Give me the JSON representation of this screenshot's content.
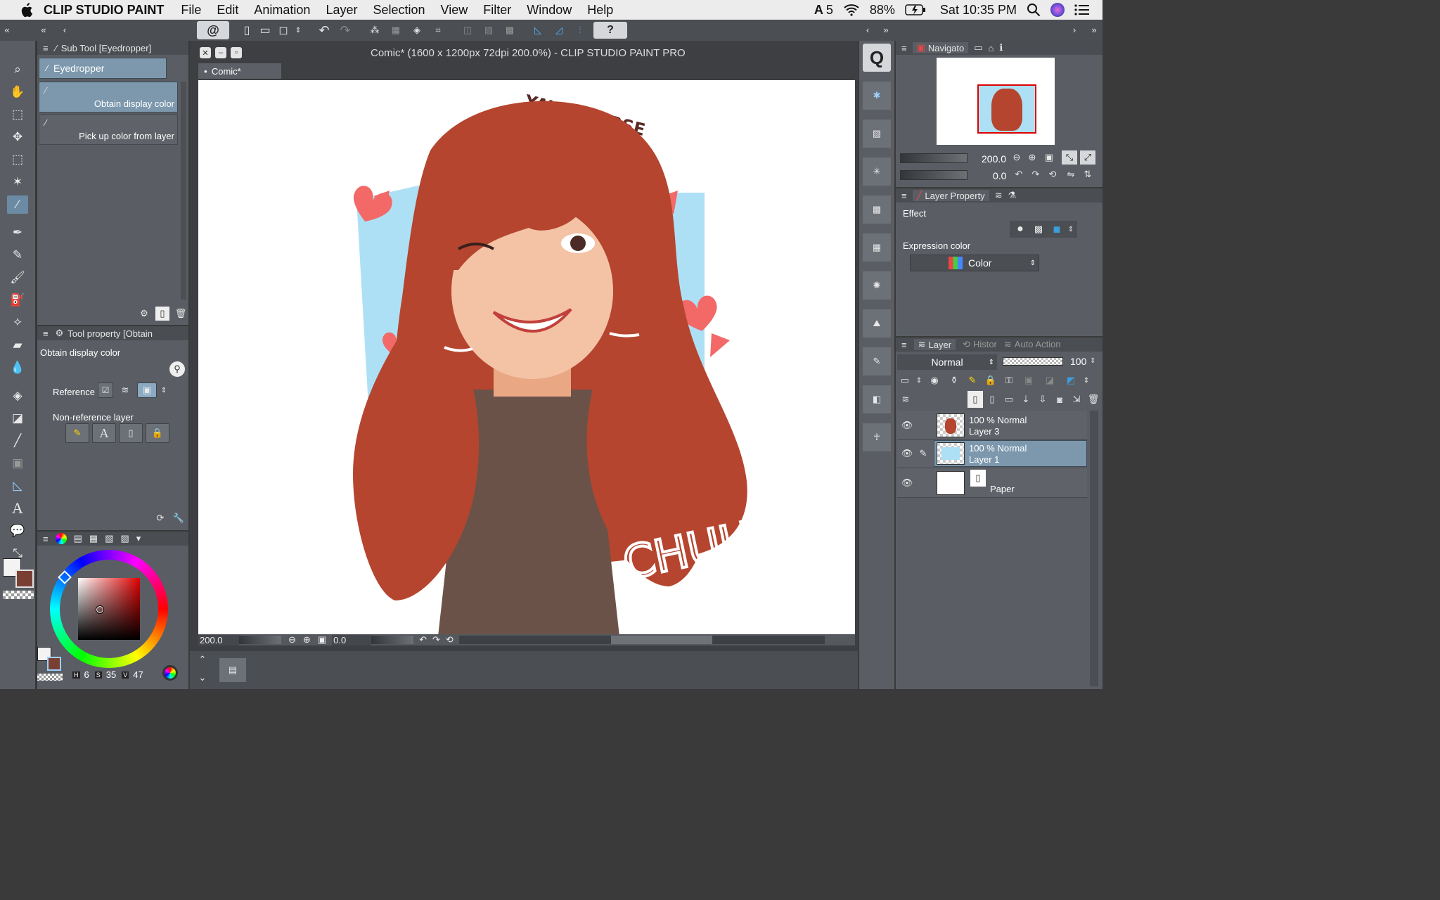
{
  "menubar": {
    "app_name": "CLIP STUDIO PAINT",
    "items": [
      "File",
      "Edit",
      "Animation",
      "Layer",
      "Selection",
      "View",
      "Filter",
      "Window",
      "Help"
    ],
    "adobe_count": "5",
    "battery": "88%",
    "clock": "Sat 10:35 PM"
  },
  "window": {
    "title": "Comic* (1600 x 1200px 72dpi 200.0%)  - CLIP STUDIO PAINT PRO",
    "tab": "Comic*"
  },
  "subtool": {
    "header": "Sub Tool [Eyedropper]",
    "group": "Eyedropper",
    "items": [
      "Obtain display color",
      "Pick up color from layer"
    ]
  },
  "toolprop": {
    "header": "Tool property [Obtain",
    "name": "Obtain display color",
    "reference_label": "Reference",
    "nonref_label": "Non-reference layer"
  },
  "color": {
    "h_label": "H",
    "h": "6",
    "s_label": "S",
    "s": "35",
    "v_label": "V",
    "v": "47"
  },
  "canvas": {
    "zoom": "200.0",
    "angle": "0.0",
    "artwork": {
      "top_text": "YAWNIVERSE",
      "bottom_text": "CHUU!!"
    }
  },
  "navigator": {
    "tab": "Navigato",
    "zoom": "200.0",
    "angle": "0.0"
  },
  "layerprop": {
    "tab": "Layer Property",
    "effect": "Effect",
    "expression": "Expression color",
    "mode": "Color"
  },
  "layers": {
    "tabs": [
      "Layer",
      "Histor",
      "Auto Action"
    ],
    "blend": "Normal",
    "opacity": "100",
    "items": [
      {
        "info": "100 % Normal",
        "name": "Layer 3"
      },
      {
        "info": "100 % Normal",
        "name": "Layer 1"
      },
      {
        "info": "",
        "name": "Paper"
      }
    ]
  },
  "colors": {
    "accent": "#3c9dd9",
    "bg_panel": "#5a5e64",
    "selected": "#6b8aa3",
    "hair": "#b5452f",
    "sky": "#aee0f5"
  }
}
